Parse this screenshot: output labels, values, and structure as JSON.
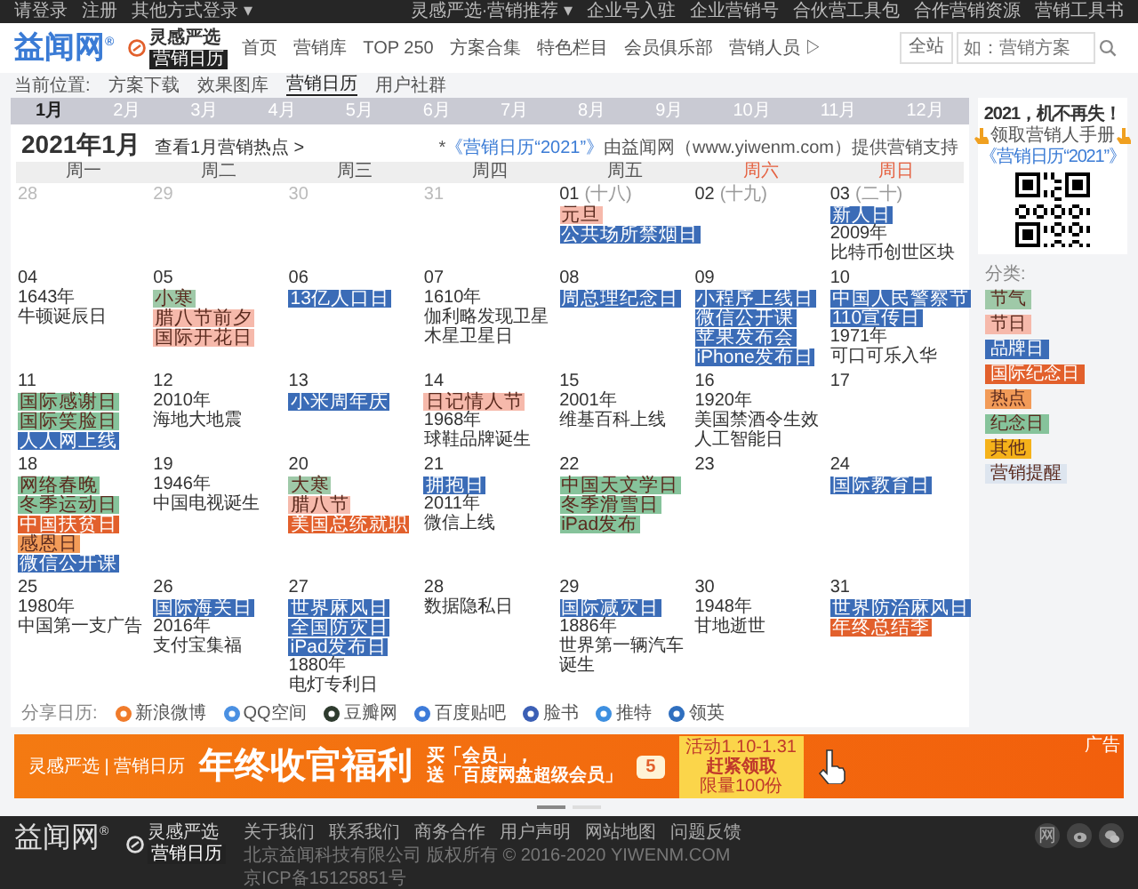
{
  "top_bar": {
    "left": [
      "请登录",
      "注册",
      "其他方式登录 ▾"
    ],
    "right": [
      "灵感严选·营销推荐 ▾",
      "企业号入驻",
      "企业营销号",
      "合伙营工具包",
      "合作营销资源",
      "营销工具书"
    ]
  },
  "header": {
    "logo": "益闻网$^{®}$",
    "brand": "灵感严选",
    "brand_badge": "营销日历",
    "nav": [
      "首页",
      "营销库",
      "TOP 250",
      "方案合集",
      "特色栏目",
      "会员俱乐部",
      "营销人员 ▷"
    ],
    "search": {
      "scope": "全站",
      "placeholder": "如：营销方案"
    }
  },
  "breadcrumb": {
    "label": "当前位置:",
    "items": [
      {
        "label": "方案下载",
        "selected": false
      },
      {
        "label": "效果图库",
        "selected": false
      },
      {
        "label": "营销日历",
        "selected": true
      },
      {
        "label": "用户社群",
        "selected": false
      }
    ]
  },
  "months": [
    {
      "label": "1月",
      "selected": true
    },
    {
      "label": "2月",
      "selected": false
    },
    {
      "label": "3月",
      "selected": false
    },
    {
      "label": "4月",
      "selected": false
    },
    {
      "label": "5月",
      "selected": false
    },
    {
      "label": "6月",
      "selected": false
    },
    {
      "label": "7月",
      "selected": false
    },
    {
      "label": "8月",
      "selected": false
    },
    {
      "label": "9月",
      "selected": false
    },
    {
      "label": "10月",
      "selected": false
    },
    {
      "label": "11月",
      "selected": false
    },
    {
      "label": "12月",
      "selected": false
    }
  ],
  "calendar": {
    "title": "2021年1月",
    "hot_link": "查看1月营销热点 >",
    "note_prefix": "*",
    "note_link": "《营销日历“2021”》",
    "note_rest": "由益闻网（www.yiwenm.com）提供营销支持",
    "weekdays": [
      {
        "label": "周一",
        "weekend": false
      },
      {
        "label": "周二",
        "weekend": false
      },
      {
        "label": "周三",
        "weekend": false
      },
      {
        "label": "周四",
        "weekend": false
      },
      {
        "label": "周五",
        "weekend": false
      },
      {
        "label": "周六",
        "weekend": true
      },
      {
        "label": "周日",
        "weekend": true
      }
    ],
    "days": [
      {
        "day": "28",
        "outside": true
      },
      {
        "day": "29",
        "outside": true
      },
      {
        "day": "30",
        "outside": true
      },
      {
        "day": "31",
        "outside": true
      },
      {
        "day": "01",
        "outside": false,
        "lunar": "(十八)",
        "events": [
          {
            "kind": "tag",
            "text": "元旦",
            "color": "#f6b9ab"
          },
          {
            "kind": "tag",
            "text": "公共场所禁烟日",
            "color": "#3b6cb7"
          }
        ]
      },
      {
        "day": "02",
        "outside": false,
        "lunar": "(十九)"
      },
      {
        "day": "03",
        "outside": false,
        "lunar": "(二十)",
        "events": [
          {
            "kind": "tag",
            "text": "新人日",
            "color": "#3b6cb7"
          },
          {
            "kind": "text",
            "text": "2009年"
          },
          {
            "kind": "text",
            "text": "比特币创世区块"
          }
        ]
      },
      {
        "day": "04",
        "outside": false,
        "events": [
          {
            "kind": "text",
            "text": "1643年"
          },
          {
            "kind": "text",
            "text": "牛顿诞辰日"
          }
        ]
      },
      {
        "day": "05",
        "outside": false,
        "events": [
          {
            "kind": "tag",
            "text": "小寒",
            "color": "#9fc9a8"
          },
          {
            "kind": "tag",
            "text": "腊八节前夕",
            "color": "#f6b9ab"
          },
          {
            "kind": "tag",
            "text": "国际开花日",
            "color": "#f6b9ab"
          }
        ]
      },
      {
        "day": "06",
        "outside": false,
        "events": [
          {
            "kind": "tag",
            "text": "13亿人口日",
            "color": "#3b6cb7"
          }
        ]
      },
      {
        "day": "07",
        "outside": false,
        "events": [
          {
            "kind": "text",
            "text": "1610年"
          },
          {
            "kind": "text",
            "text": "伽利略发现卫星"
          },
          {
            "kind": "text",
            "text": "木星卫星日"
          }
        ]
      },
      {
        "day": "08",
        "outside": false,
        "events": [
          {
            "kind": "tag",
            "text": "周总理纪念日",
            "color": "#3b6cb7"
          }
        ]
      },
      {
        "day": "09",
        "outside": false,
        "events": [
          {
            "kind": "tag",
            "text": "小程序上线日",
            "color": "#3b6cb7"
          },
          {
            "kind": "tag",
            "text": "微信公开课",
            "color": "#3b6cb7"
          },
          {
            "kind": "tag",
            "text": "苹果发布会",
            "color": "#3b6cb7"
          },
          {
            "kind": "tag",
            "text": "iPhone发布日",
            "color": "#3b6cb7"
          }
        ]
      },
      {
        "day": "10",
        "outside": false,
        "events": [
          {
            "kind": "tag",
            "text": "中国人民警察节",
            "color": "#3b6cb7"
          },
          {
            "kind": "tag",
            "text": "110宣传日",
            "color": "#3b6cb7"
          },
          {
            "kind": "text",
            "text": "1971年"
          },
          {
            "kind": "text",
            "text": "可口可乐入华"
          }
        ]
      },
      {
        "day": "11",
        "outside": false,
        "events": [
          {
            "kind": "tag",
            "text": "国际感谢日",
            "color": "#86c39b"
          },
          {
            "kind": "tag",
            "text": "国际笑脸日",
            "color": "#86c39b"
          },
          {
            "kind": "tag",
            "text": "人人网上线",
            "color": "#3b6cb7"
          }
        ]
      },
      {
        "day": "12",
        "outside": false,
        "events": [
          {
            "kind": "text",
            "text": "2010年"
          },
          {
            "kind": "text",
            "text": "海地大地震"
          }
        ]
      },
      {
        "day": "13",
        "outside": false,
        "events": [
          {
            "kind": "tag",
            "text": "小米周年庆",
            "color": "#3b6cb7"
          }
        ]
      },
      {
        "day": "14",
        "outside": false,
        "events": [
          {
            "kind": "tag",
            "text": "日记情人节",
            "color": "#f6b9ab"
          },
          {
            "kind": "text",
            "text": "1968年"
          },
          {
            "kind": "text",
            "text": "球鞋品牌诞生"
          }
        ]
      },
      {
        "day": "15",
        "outside": false,
        "events": [
          {
            "kind": "text",
            "text": "2001年"
          },
          {
            "kind": "text",
            "text": "维基百科上线"
          }
        ]
      },
      {
        "day": "16",
        "outside": false,
        "events": [
          {
            "kind": "text",
            "text": "1920年"
          },
          {
            "kind": "text",
            "text": "美国禁酒令生效"
          },
          {
            "kind": "text",
            "text": "人工智能日"
          }
        ]
      },
      {
        "day": "17",
        "outside": false
      },
      {
        "day": "18",
        "outside": false,
        "events": [
          {
            "kind": "tag",
            "text": "网络春晚",
            "color": "#86c39b"
          },
          {
            "kind": "tag",
            "text": "冬季运动日",
            "color": "#86c39b"
          },
          {
            "kind": "tag",
            "text": "中国扶贫日",
            "color": "#e2602c"
          },
          {
            "kind": "tag",
            "text": "感恩日",
            "color": "#f29b58"
          },
          {
            "kind": "tag",
            "text": "微信公开课",
            "color": "#3b6cb7"
          }
        ]
      },
      {
        "day": "19",
        "outside": false,
        "events": [
          {
            "kind": "text",
            "text": "1946年"
          },
          {
            "kind": "text",
            "text": "中国电视诞生"
          }
        ]
      },
      {
        "day": "20",
        "outside": false,
        "events": [
          {
            "kind": "tag",
            "text": "大寒",
            "color": "#9fc9a8"
          },
          {
            "kind": "tag",
            "text": "腊八节",
            "color": "#f6b9ab"
          },
          {
            "kind": "tag",
            "text": "美国总统就职",
            "color": "#e2602c"
          }
        ]
      },
      {
        "day": "21",
        "outside": false,
        "events": [
          {
            "kind": "tag",
            "text": "拥抱日",
            "color": "#3b6cb7"
          },
          {
            "kind": "text",
            "text": "2011年"
          },
          {
            "kind": "text",
            "text": "微信上线"
          }
        ]
      },
      {
        "day": "22",
        "outside": false,
        "events": [
          {
            "kind": "tag",
            "text": "中国天文学日",
            "color": "#86c39b"
          },
          {
            "kind": "tag",
            "text": "冬季滑雪日",
            "color": "#86c39b"
          },
          {
            "kind": "tag",
            "text": "iPad发布",
            "color": "#86c39b"
          }
        ]
      },
      {
        "day": "23",
        "outside": false
      },
      {
        "day": "24",
        "outside": false,
        "events": [
          {
            "kind": "tag",
            "text": "国际教育日",
            "color": "#3b6cb7"
          }
        ]
      },
      {
        "day": "25",
        "outside": false,
        "events": [
          {
            "kind": "text",
            "text": "1980年"
          },
          {
            "kind": "text",
            "text": "中国第一支广告"
          }
        ]
      },
      {
        "day": "26",
        "outside": false,
        "events": [
          {
            "kind": "tag",
            "text": "国际海关日",
            "color": "#3b6cb7"
          },
          {
            "kind": "text",
            "text": "2016年"
          },
          {
            "kind": "text",
            "text": "支付宝集福"
          }
        ]
      },
      {
        "day": "27",
        "outside": false,
        "events": [
          {
            "kind": "tag",
            "text": "世界麻风日",
            "color": "#3b6cb7"
          },
          {
            "kind": "tag",
            "text": "全国防灾日",
            "color": "#3b6cb7"
          },
          {
            "kind": "tag",
            "text": "iPad发布日",
            "color": "#3b6cb7"
          },
          {
            "kind": "text",
            "text": "1880年"
          },
          {
            "kind": "text",
            "text": "电灯专利日"
          }
        ]
      },
      {
        "day": "28",
        "outside": false,
        "events": [
          {
            "kind": "text",
            "text": "数据隐私日"
          }
        ]
      },
      {
        "day": "29",
        "outside": false,
        "events": [
          {
            "kind": "tag",
            "text": "国际减灾日",
            "color": "#3b6cb7"
          },
          {
            "kind": "text",
            "text": "1886年"
          },
          {
            "kind": "text",
            "text": "世界第一辆汽车"
          },
          {
            "kind": "text",
            "text": "诞生"
          }
        ]
      },
      {
        "day": "30",
        "outside": false,
        "events": [
          {
            "kind": "text",
            "text": "1948年"
          },
          {
            "kind": "text",
            "text": "甘地逝世"
          }
        ]
      },
      {
        "day": "31",
        "outside": false,
        "events": [
          {
            "kind": "tag",
            "text": "世界防治麻风日",
            "color": "#3b6cb7"
          },
          {
            "kind": "tag",
            "text": "年终总结季",
            "color": "#e2602c"
          }
        ]
      }
    ]
  },
  "share": {
    "label": "分享日历:",
    "items": [
      "新浪微博",
      "QQ空间",
      "豆瓣网",
      "百度贴吧",
      "脸书",
      "推特",
      "领英"
    ]
  },
  "sidebar": {
    "promo_title": "2021，机不再失！",
    "promo_text": "领取营销人手册",
    "promo_link": "《营销日历“2021”》",
    "legend_label": "分类:",
    "legend": [
      {
        "label": "节气",
        "color": "#9fc9a8"
      },
      {
        "label": "节日",
        "color": "#f6b9ab"
      },
      {
        "label": "品牌日",
        "color": "#3b6cb7"
      },
      {
        "label": "国际纪念日",
        "color": "#e2602c"
      },
      {
        "label": "热点",
        "color": "#f29b58"
      },
      {
        "label": "纪念日",
        "color": "#86c39b"
      },
      {
        "label": "其他",
        "color": "#f5b21a"
      },
      {
        "label": "营销提醒",
        "color": "#dde5ef"
      }
    ]
  },
  "banner": {
    "brand": "灵感严选 | 营销日历",
    "headline": "年终收官福利",
    "offer_lines": [
      "买「会员」，",
      "送「百度网盘超级会员」"
    ],
    "coupon": "5",
    "period": "活动1.10-1.31",
    "cta": "赶紧领取",
    "limit": "限量100份",
    "ad_label": "广告"
  },
  "carousel": [
    {
      "selected": true
    },
    {
      "selected": false
    }
  ],
  "footer": {
    "logo": "益闻网$^{®}$",
    "brand": "灵感严选",
    "brand_badge": "营销日历",
    "links": [
      "关于我们",
      "联系我们",
      "商务合作",
      "用户声明",
      "网站地图",
      "问题反馈"
    ],
    "copyright": "北京益闻科技有限公司 版权所有 © 2016-2020 YIWENM.COM",
    "icp": "京ICP备15125851号",
    "social_text": "网"
  }
}
